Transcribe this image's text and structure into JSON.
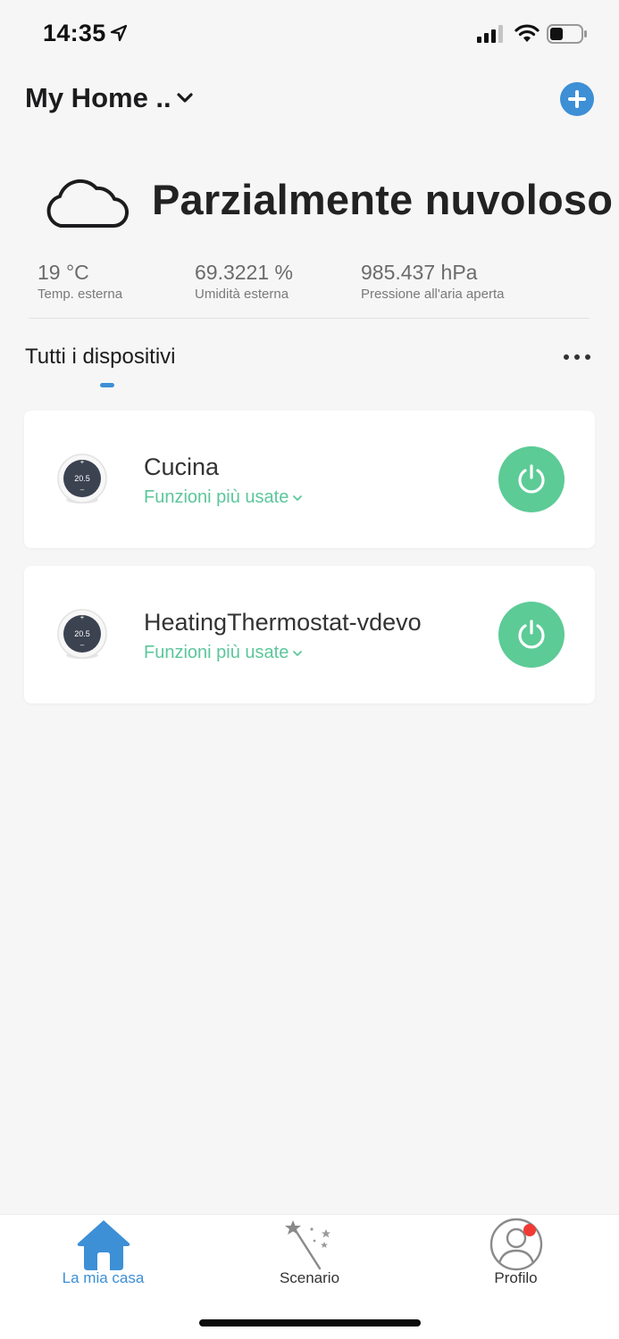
{
  "status_bar": {
    "time": "14:35"
  },
  "header": {
    "home_title": "My Home .."
  },
  "weather": {
    "condition": "Parzialmente nuvoloso",
    "stats": [
      {
        "value": "19 °C",
        "label": "Temp. esterna"
      },
      {
        "value": "69.3221 %",
        "label": "Umidità esterna"
      },
      {
        "value": "985.437 hPa",
        "label": "Pressione all'aria aperta"
      }
    ]
  },
  "section": {
    "title": "Tutti i dispositivi"
  },
  "devices": [
    {
      "name": "Cucina",
      "subtitle": "Funzioni più usate",
      "display_temp": "20.5"
    },
    {
      "name": "HeatingThermostat-vdevo",
      "subtitle": "Funzioni più usate",
      "display_temp": "20.5"
    }
  ],
  "tab_bar": {
    "items": [
      {
        "label": "La mia casa",
        "icon": "home-icon"
      },
      {
        "label": "Scenario",
        "icon": "magic-wand-icon"
      },
      {
        "label": "Profilo",
        "icon": "profile-icon"
      }
    ]
  },
  "colors": {
    "accent_blue": "#3d8fd6",
    "power_green": "#5ccb96",
    "link_green": "#5cc79a",
    "notification_red": "#ef3b34",
    "background": "#f6f6f6"
  }
}
